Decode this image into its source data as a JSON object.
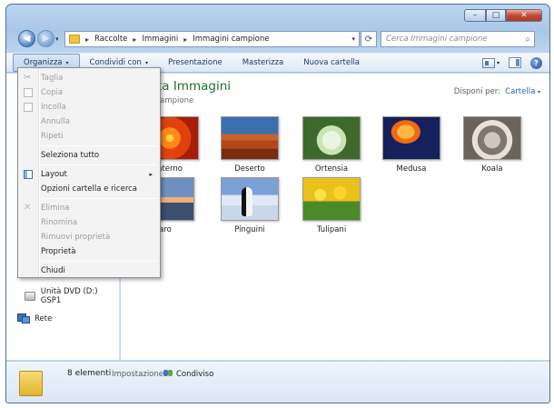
{
  "window": {
    "caption": {
      "minimize": "–",
      "maximize": "□",
      "close": "✕"
    }
  },
  "nav": {
    "back_glyph": "◀",
    "forward_glyph": "▶",
    "dropdown_glyph": "▾"
  },
  "address": {
    "crumbs": [
      "Raccolte",
      "Immagini",
      "Immagini campione"
    ],
    "separator": "▸",
    "refresh_glyph": "⟳"
  },
  "search": {
    "placeholder": "Cerca Immagini campione",
    "icon_glyph": "⌕"
  },
  "toolbar": {
    "organize": "Organizza",
    "share": "Condividi con",
    "slideshow": "Presentazione",
    "burn": "Masterizza",
    "new_folder": "Nuova cartella",
    "help_glyph": "?",
    "dropdown_glyph": "▾"
  },
  "library": {
    "title_fragment": "olta Immagini",
    "subtitle_fragment": "ni campione",
    "arrange_label": "Disponi per:",
    "arrange_value": "Cartella"
  },
  "items": [
    {
      "label": "nterno"
    },
    {
      "label": "Deserto"
    },
    {
      "label": "Ortensia"
    },
    {
      "label": "Medusa"
    },
    {
      "label": "Koala"
    },
    {
      "label": "aro"
    },
    {
      "label": "Pinguini"
    },
    {
      "label": "Tulipani"
    }
  ],
  "navpane": {
    "dvd": "Unità DVD (D:) GSP1",
    "network": "Rete"
  },
  "details": {
    "count": "8 elementi",
    "setting_label": "Impostazione:",
    "setting_value": "Condiviso"
  },
  "menu": {
    "cut": "Taglia",
    "copy": "Copia",
    "paste": "Incolla",
    "undo": "Annulla",
    "redo": "Ripeti",
    "select_all": "Seleziona tutto",
    "layout": "Layout",
    "folder_options": "Opzioni cartella e ricerca",
    "delete": "Elimina",
    "rename": "Rinomina",
    "remove_properties": "Rimuovi proprietà",
    "properties": "Proprietà",
    "close": "Chiudi",
    "submenu_glyph": "▸",
    "cut_glyph": "✂",
    "delete_glyph": "✕"
  }
}
